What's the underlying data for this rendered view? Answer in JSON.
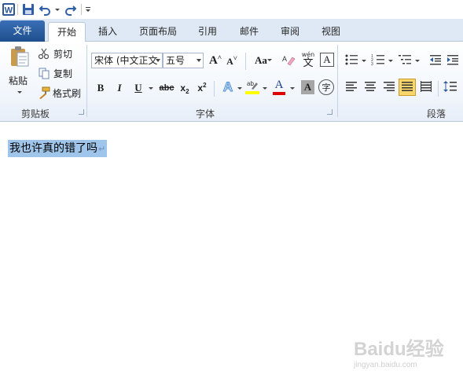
{
  "quick_access": {
    "app_icon": "word-icon",
    "save_icon": "save-icon",
    "undo_icon": "undo-icon",
    "redo_icon": "redo-icon",
    "customize_icon": "customize-arrow-icon"
  },
  "tabs": {
    "file": "文件",
    "items": [
      "开始",
      "插入",
      "页面布局",
      "引用",
      "邮件",
      "审阅",
      "视图"
    ],
    "active": "开始"
  },
  "clipboard": {
    "paste": "粘贴",
    "cut": "剪切",
    "copy": "复制",
    "format_painter": "格式刷",
    "group_label": "剪贴板"
  },
  "font": {
    "font_name": "宋体 (中文正文",
    "font_size": "五号",
    "grow_glyph": "A",
    "shrink_glyph": "A",
    "change_case": "Aa",
    "pinyin_label": "wén",
    "pinyin_char": "文",
    "bold": "B",
    "italic": "I",
    "underline": "U",
    "strikethrough": "abc",
    "subscript": "x",
    "superscript": "x",
    "sub_mark": "2",
    "sup_mark": "2",
    "font_color_glyph": "A",
    "shading_glyph": "A",
    "enclose_glyph": "字",
    "group_label": "字体"
  },
  "paragraph": {
    "group_label": "段落"
  },
  "document": {
    "selected_text": "我也许真的错了吗",
    "paragraph_mark": "↵"
  },
  "watermark": {
    "brand": "Baidu经验",
    "url": "jingyan.baidu.com"
  },
  "colors": {
    "file_tab": "#2b5797",
    "selection": "#9fc6ea",
    "font_color_bar": "#e00000",
    "highlight_bar": "#ffff00",
    "justify_active": "#fbd66a"
  }
}
